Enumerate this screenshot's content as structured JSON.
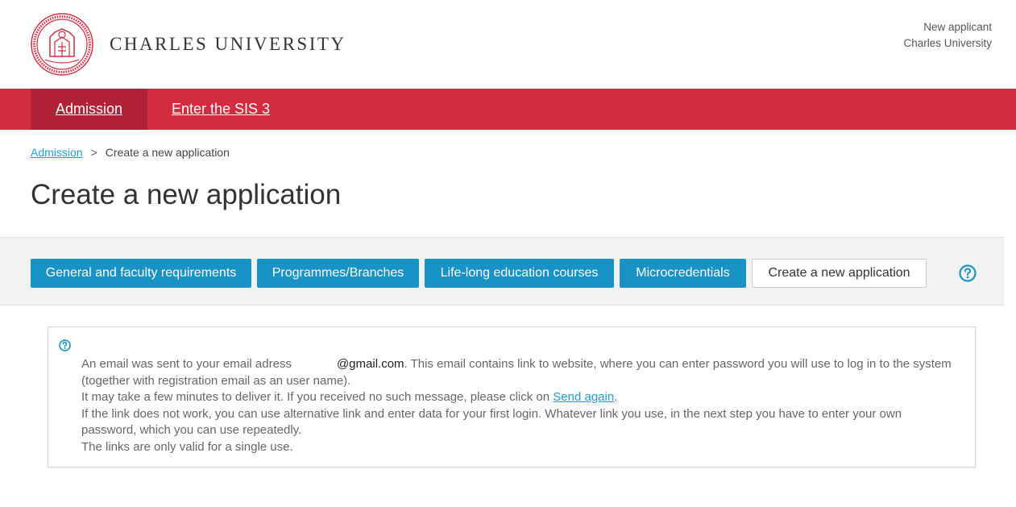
{
  "header": {
    "brand": "CHARLES UNIVERSITY",
    "user_line1": "New applicant",
    "user_line2": "Charles University",
    "seal_icon": "university-seal-icon"
  },
  "nav": {
    "items": [
      {
        "label": "Admission",
        "active": true
      },
      {
        "label": "Enter the SIS 3",
        "active": false
      }
    ]
  },
  "breadcrumb": {
    "root": "Admission",
    "separator": ">",
    "current": "Create a new application"
  },
  "page": {
    "title": "Create a new application"
  },
  "tabs": [
    {
      "label": "General and faculty requirements",
      "current": false
    },
    {
      "label": "Programmes/Branches",
      "current": false
    },
    {
      "label": "Life-long education courses",
      "current": false
    },
    {
      "label": "Microcredentials",
      "current": false
    },
    {
      "label": "Create a new application",
      "current": true
    }
  ],
  "info": {
    "line1_prefix": "An email was sent to your email adress",
    "email_domain": "@gmail.com",
    "line1_suffix": ". This email contains link to website, where you can enter password you will use to log in to the system (together with registration email as an user name).",
    "line2_prefix": "It may take a few minutes to deliver it. If you received no such message, please click on ",
    "send_again": "Send again",
    "line2_suffix": ".",
    "line3": "If the link does not work, you can use alternative link and enter data for your first login. Whatever link you use, in the next step you have to enter your own password, which you can use repeatedly.",
    "line4": "The links are only valid for a single use."
  },
  "colors": {
    "brand_red": "#d22c3f",
    "active_red": "#b22236",
    "button_blue": "#1992c6",
    "link_blue": "#1aa0d6"
  }
}
